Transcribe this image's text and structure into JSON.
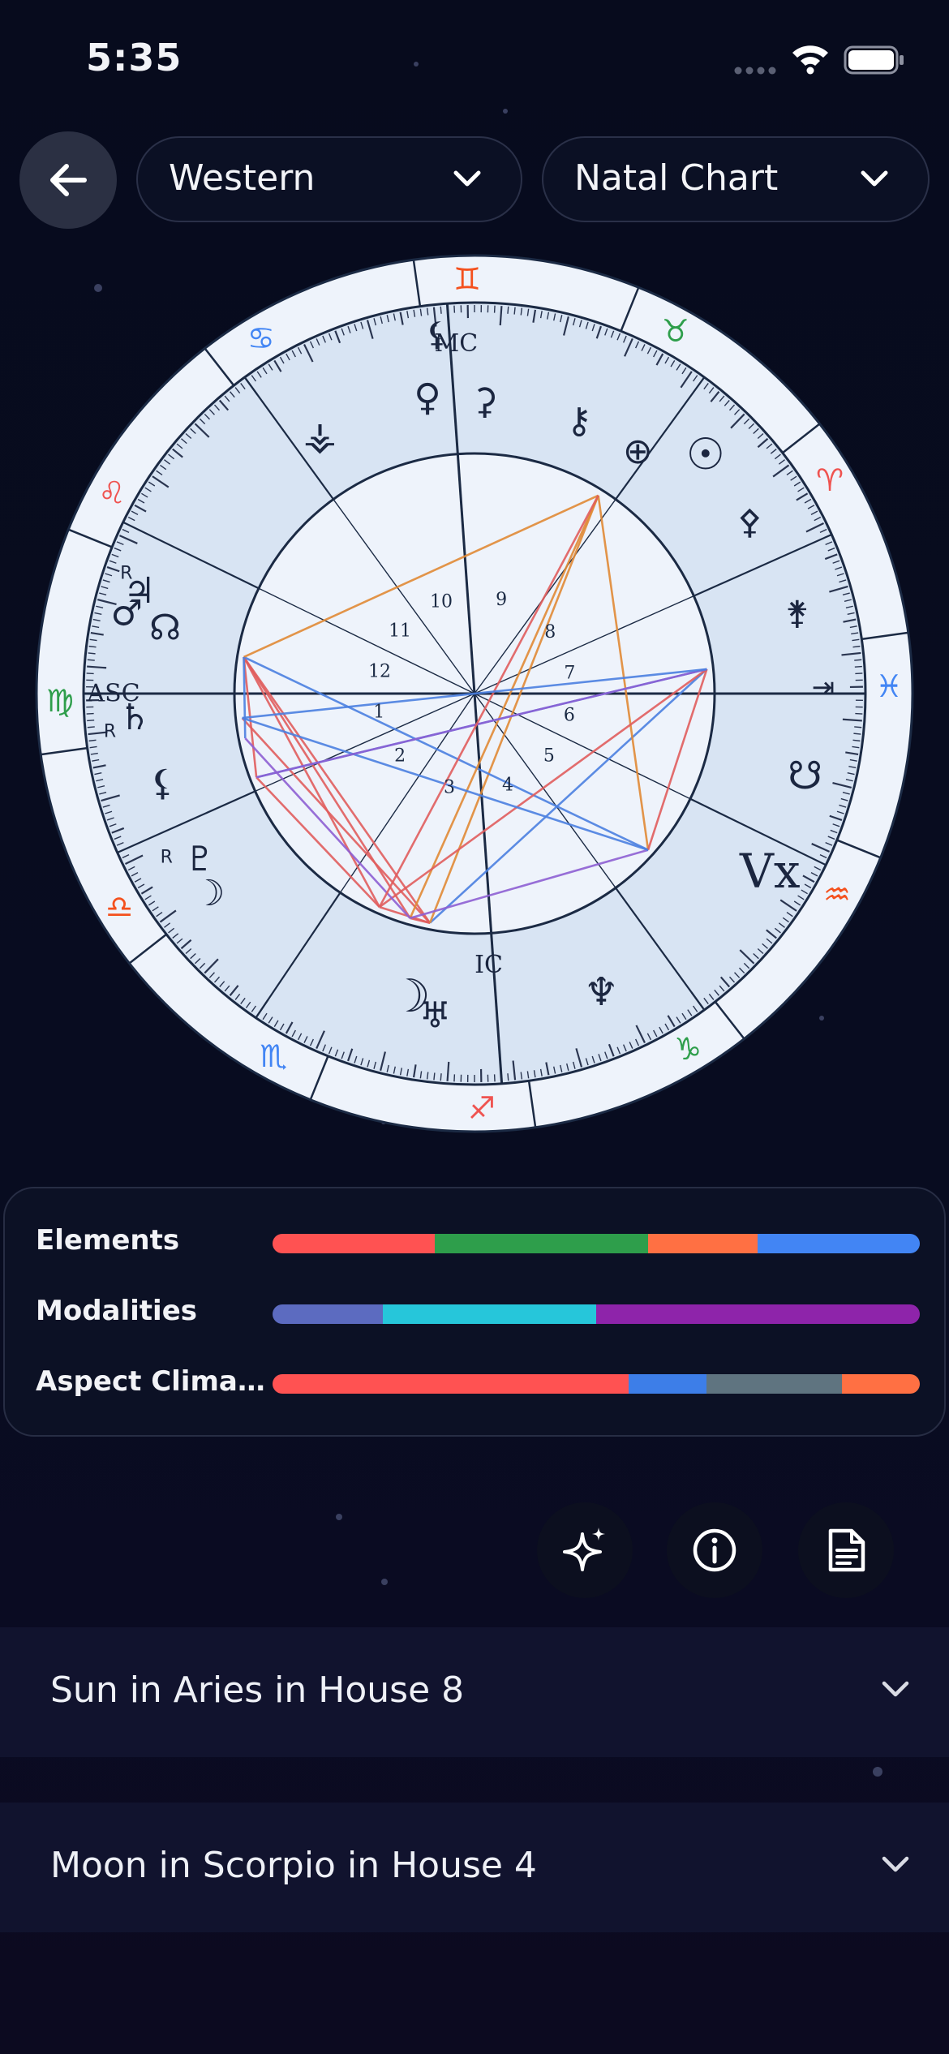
{
  "status": {
    "time": "5:35"
  },
  "header": {
    "back_icon": "arrow-left-icon",
    "system_select": {
      "value": "Western"
    },
    "chart_select": {
      "value": "Natal Chart"
    }
  },
  "chart": {
    "houses": [
      "1",
      "2",
      "3",
      "4",
      "5",
      "6",
      "7",
      "8",
      "9",
      "10",
      "11",
      "12"
    ],
    "angle_labels": {
      "asc": "ASC",
      "mc": "MC",
      "ic": "IC",
      "vertex": "Vx"
    },
    "sign_glyphs": [
      "♉",
      "♊",
      "♋",
      "♌",
      "♍",
      "♎",
      "♏",
      "♐",
      "♑",
      "♒",
      "♓",
      "♈"
    ],
    "planet_glyphs": {
      "mc_glyph": "⚸",
      "ceres": "⚳",
      "venus": "♀",
      "chiron": "⚷",
      "sun": "☉",
      "part_of_fortune": "⊕",
      "pallas": "⚴",
      "juno": "⚵",
      "descendant_glyph": "⇥",
      "south_node": "☋",
      "vertex": "Vx",
      "neptune": "♆",
      "moon_lower": "☽",
      "uranus": "♅",
      "eris": "⯰",
      "pluto": "♇",
      "moon_left": "☽",
      "saturn": "♄",
      "lilith": "⚸",
      "mars": "♂",
      "jupiter": "♃",
      "north_node": "☊",
      "vesta": "⚶",
      "retrograde": "R"
    },
    "colors": {
      "fire": "#ef5350",
      "earth": "#43a047",
      "air": "#4285f4",
      "water": "#f57c00"
    }
  },
  "stats": {
    "elements": {
      "label": "Elements",
      "segments": [
        {
          "color": "#ff5252",
          "value": 25
        },
        {
          "color": "#2e9e4b",
          "value": 33
        },
        {
          "color": "#ff7043",
          "value": 17
        },
        {
          "color": "#4285f4",
          "value": 25
        }
      ]
    },
    "modalities": {
      "label": "Modalities",
      "segments": [
        {
          "color": "#5c6bc0",
          "value": 17
        },
        {
          "color": "#26c6da",
          "value": 33
        },
        {
          "color": "#8e24aa",
          "value": 50
        }
      ]
    },
    "aspect_climate": {
      "label": "Aspect Clima…",
      "segments": [
        {
          "color": "#ff5252",
          "value": 55
        },
        {
          "color": "#3d7ee8",
          "value": 12
        },
        {
          "color": "#5f7480",
          "value": 21
        },
        {
          "color": "#ff7043",
          "value": 12
        }
      ]
    }
  },
  "actions": {
    "sparkle_icon": "sparkle-icon",
    "info_icon": "info-icon",
    "report_icon": "document-icon"
  },
  "interpretations": [
    {
      "title": "Sun in Aries in House 8"
    },
    {
      "title": "Moon in Scorpio in House 4"
    }
  ]
}
